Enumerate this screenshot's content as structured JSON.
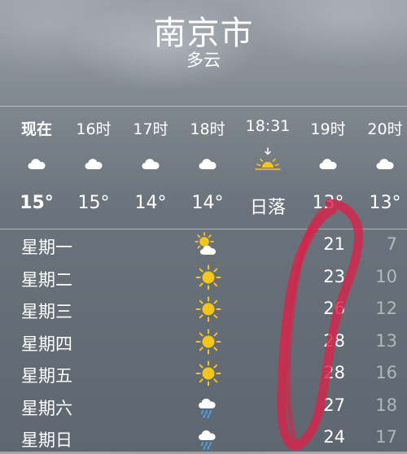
{
  "header": {
    "city": "南京市",
    "condition": "多云"
  },
  "hourly": [
    {
      "time": "现在",
      "icon": "cloud-icon",
      "value": "15°",
      "now": true
    },
    {
      "time": "16时",
      "icon": "cloud-icon",
      "value": "15°"
    },
    {
      "time": "17时",
      "icon": "cloud-icon",
      "value": "14°"
    },
    {
      "time": "18时",
      "icon": "cloud-icon",
      "value": "14°"
    },
    {
      "time": "18:31",
      "icon": "sunset-icon",
      "value": "日落"
    },
    {
      "time": "19时",
      "icon": "cloud-icon",
      "value": "13°"
    },
    {
      "time": "20时",
      "icon": "cloud-icon",
      "value": "13°"
    }
  ],
  "daily": [
    {
      "day": "星期一",
      "icon": "partly-sunny-icon",
      "high": "21",
      "low": "7"
    },
    {
      "day": "星期二",
      "icon": "sun-icon",
      "high": "23",
      "low": "10"
    },
    {
      "day": "星期三",
      "icon": "sun-icon",
      "high": "26",
      "low": "12"
    },
    {
      "day": "星期四",
      "icon": "sun-icon",
      "high": "28",
      "low": "13"
    },
    {
      "day": "星期五",
      "icon": "sun-icon",
      "high": "28",
      "low": "16"
    },
    {
      "day": "星期六",
      "icon": "rain-icon",
      "high": "27",
      "low": "18"
    },
    {
      "day": "星期日",
      "icon": "rain-icon",
      "high": "24",
      "low": "17"
    }
  ],
  "colors": {
    "sun": "#f5c518",
    "rain": "#4aa3f0",
    "annotation": "#d8234a"
  }
}
